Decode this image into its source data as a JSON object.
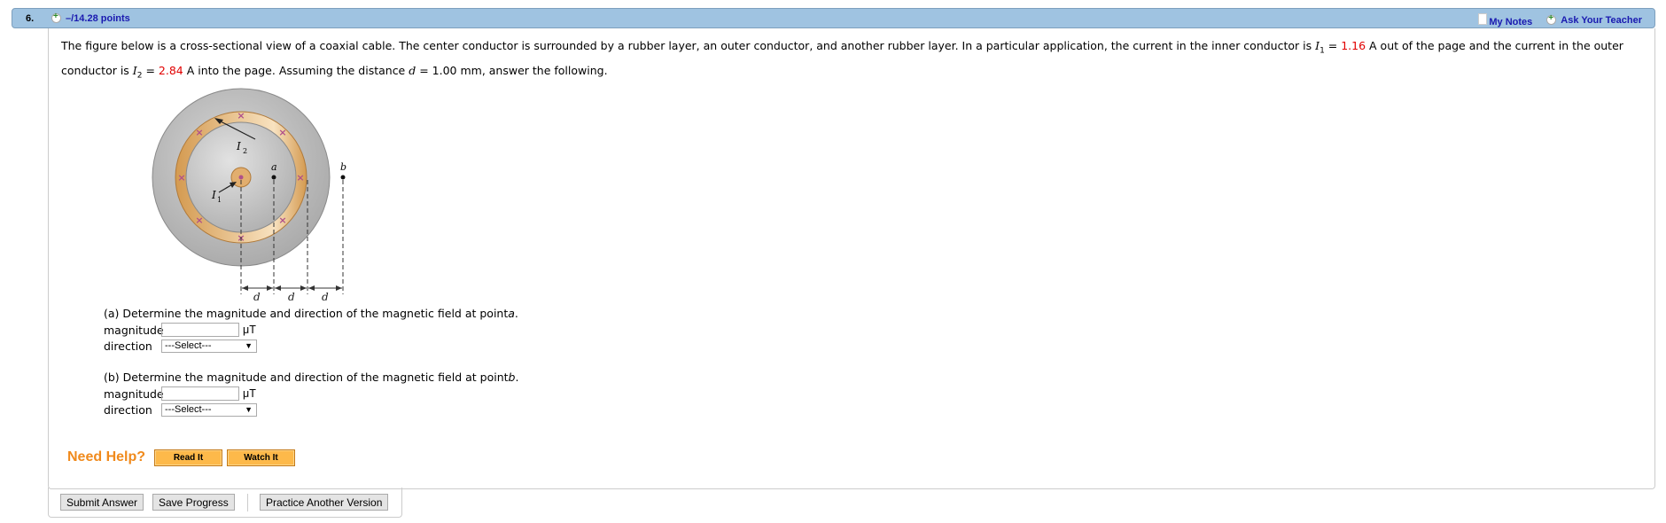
{
  "header": {
    "question_number": "6.",
    "points": "–/14.28 points",
    "my_notes": "My Notes",
    "ask_teacher": "Ask Your Teacher"
  },
  "question": {
    "line1_a": "The figure below is a cross-sectional view of a coaxial cable. The center conductor is surrounded by a rubber layer, an outer conductor, and another rubber layer. In a particular application, the current in the inner conductor is ",
    "I1_sym": "I",
    "I1_sub": "1",
    "eq": " = ",
    "I1_val": "1.16",
    "line1_b": " A out of the page and the current in the outer",
    "line2_a": "conductor is ",
    "I2_sym": "I",
    "I2_sub": "2",
    "I2_val": "2.84",
    "line2_b": " A into the page. Assuming the distance ",
    "d_sym": "d",
    "line2_c": " = 1.00 mm, answer the following."
  },
  "figure": {
    "label_I1": "I",
    "label_I1_sub": "1",
    "label_I2": "I",
    "label_I2_sub": "2",
    "label_a": "a",
    "label_b": "b",
    "label_d": "d"
  },
  "parts": [
    {
      "prompt": "(a) Determine the magnitude and direction of the magnetic field at point ",
      "point": "a",
      "magnitude_label": "magnitude",
      "magnitude_value": "",
      "unit": "μT",
      "direction_label": "direction",
      "direction_selected": "---Select---"
    },
    {
      "prompt": "(b) Determine the magnitude and direction of the magnetic field at point ",
      "point": "b",
      "magnitude_label": "magnitude",
      "magnitude_value": "",
      "unit": "μT",
      "direction_label": "direction",
      "direction_selected": "---Select---"
    }
  ],
  "help": {
    "label": "Need Help?",
    "read_it": "Read It",
    "watch_it": "Watch It"
  },
  "actions": {
    "submit": "Submit Answer",
    "save": "Save Progress",
    "practice": "Practice Another Version"
  },
  "colors": {
    "header_bg": "#9fc3e1",
    "link": "#1a1ab0",
    "value_red": "#e10000",
    "help_orange": "#f08a1c",
    "help_button": "#fdb94a"
  }
}
